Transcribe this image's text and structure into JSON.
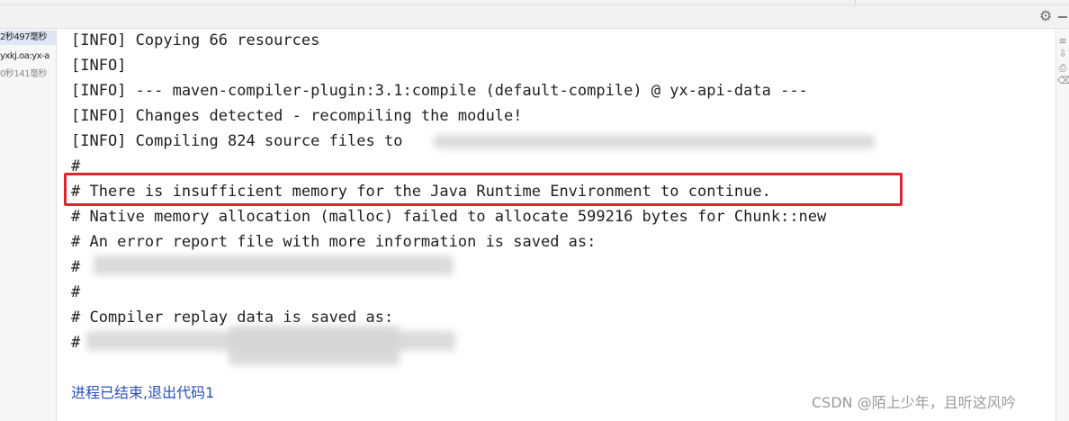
{
  "left_panel": {
    "items": [
      {
        "text": "2秒497毫秒"
      },
      {
        "text": "yxkj.oa:yx-a"
      },
      {
        "text": "0秒141毫秒"
      }
    ]
  },
  "toolbar": {
    "settings_icon": "gear-icon",
    "hide_icon": "minus-icon"
  },
  "console": {
    "lines": [
      "[INFO] Copying 66 resources",
      "[INFO]",
      "[INFO] --- maven-compiler-plugin:3.1:compile (default-compile) @ yx-api-data ---",
      "[INFO] Changes detected - recompiling the module!",
      "[INFO] Compiling 824 source files to",
      "#",
      "# There is insufficient memory for the Java Runtime Environment to continue.",
      "# Native memory allocation (malloc) failed to allocate 599216 bytes for Chunk::new",
      "# An error report file with more information is saved as:",
      "#",
      "#",
      "# Compiler replay data is saved as:",
      "#"
    ],
    "exit_message": "进程已结束,退出代码1"
  },
  "right_gutter": {
    "icons": [
      "wrap-icon",
      "scroll-end-icon",
      "print-icon",
      "delete-icon"
    ]
  },
  "watermark": "CSDN @陌上少年，且听这风吟",
  "colors": {
    "highlight": "#e0242f",
    "exit_text": "#2a4fb8"
  }
}
